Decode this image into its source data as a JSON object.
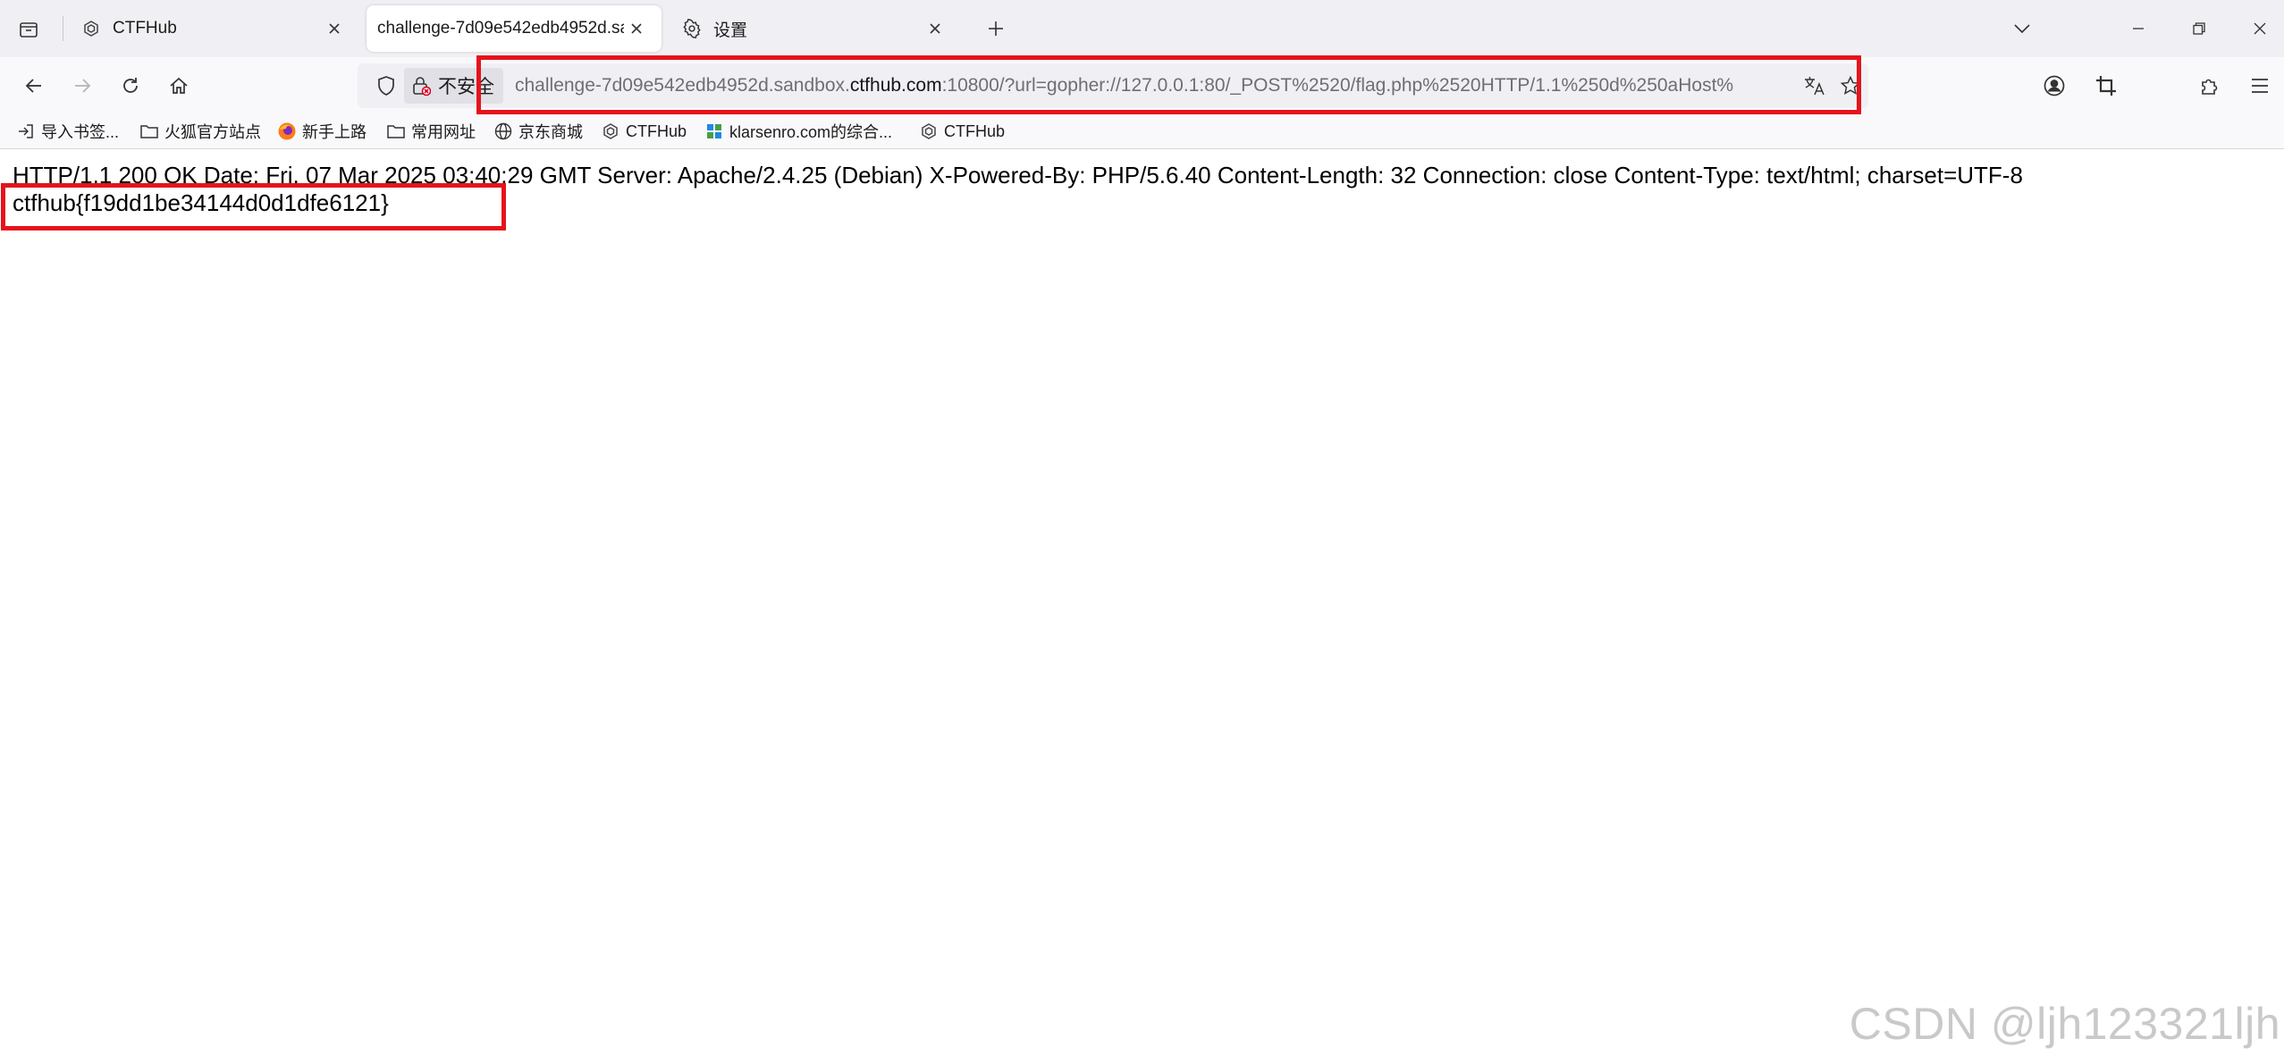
{
  "tabs": [
    {
      "title": "CTFHub",
      "icon": "ctfhub-icon",
      "active": false
    },
    {
      "title": "challenge-7d09e542edb4952d.sa",
      "icon": "",
      "active": true
    },
    {
      "title": "设置",
      "icon": "gear-icon",
      "active": false
    }
  ],
  "urlbar": {
    "security_label": "不安全",
    "url_prefix": "challenge-7d09e542edb4952d.sandbox.",
    "url_domain": "ctfhub.com",
    "url_suffix": ":10800/?url=gopher://127.0.0.1:80/_POST%2520/flag.php%2520HTTP/1.1%250d%250aHost%"
  },
  "bookmarks": [
    {
      "label": "导入书签...",
      "icon": "import-icon"
    },
    {
      "label": "火狐官方站点",
      "icon": "folder-icon"
    },
    {
      "label": "新手上路",
      "icon": "firefox-icon"
    },
    {
      "label": "常用网址",
      "icon": "folder-icon"
    },
    {
      "label": "京东商城",
      "icon": "globe-icon"
    },
    {
      "label": "CTFHub",
      "icon": "ctfhub-icon"
    },
    {
      "label": "klarsenro.com的综合...",
      "icon": "klarsenro-icon"
    },
    {
      "label": "CTFHub",
      "icon": "ctfhub-icon"
    }
  ],
  "content": {
    "response_headers": "HTTP/1.1 200 OK Date: Fri, 07 Mar 2025 03:40:29 GMT Server: Apache/2.4.25 (Debian) X-Powered-By: PHP/5.6.40 Content-Length: 32 Connection: close Content-Type: text/html; charset=UTF-8",
    "flag": "ctfhub{f19dd1be34144d0d1dfe6121}"
  },
  "watermark": "CSDN @ljh123321ljh",
  "colors": {
    "highlight": "#e5131c",
    "tabstrip_bg": "#f0f0f4",
    "toolbar_bg": "#f9f9fb"
  }
}
